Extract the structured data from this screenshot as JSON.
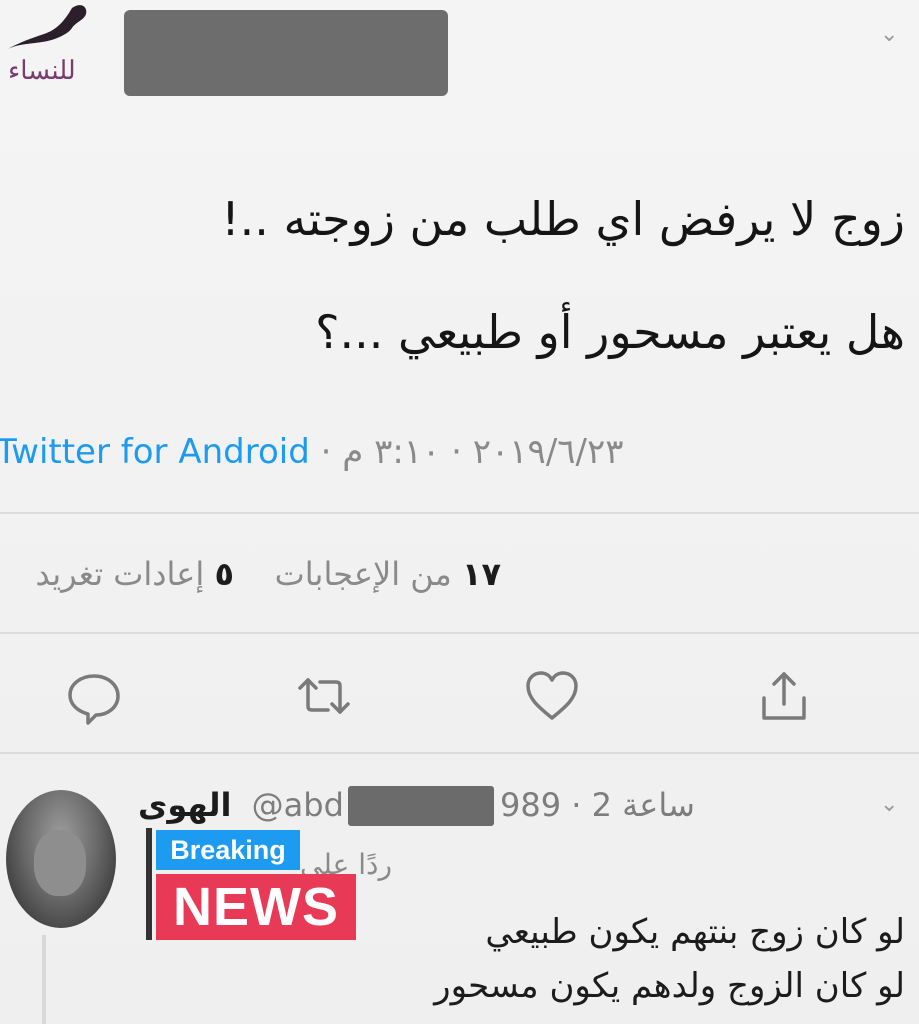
{
  "header": {
    "logo_text": "للنساء"
  },
  "tweet": {
    "line1": "زوج لا يرفض اي طلب من زوجته ..!",
    "line2": "هل يعتبر مسحور أو طبيعي ...؟",
    "time": "٣:١٠ م",
    "date": "٢٠١٩/٦/٢٣",
    "via": "Twitter for Android",
    "likes_count": "١٧",
    "likes_label": "من الإعجابات",
    "retweets_count": "٥",
    "retweets_label": "إعادات تغريد"
  },
  "reply": {
    "name": "الهوى",
    "handle_start": "@abd",
    "handle_end": "989",
    "time": "2 ساعة",
    "reply_to": "ردًا على",
    "line1": "لو كان زوج بنتهم يكون طبيعي",
    "line2": "لو كان الزوج ولدهم يكون مسحور"
  },
  "badge": {
    "top": "Breaking",
    "main": "NEWS"
  },
  "colors": {
    "link": "#1d9bf0",
    "badge_red": "#e83a56",
    "badge_blue": "#1d9bf0"
  }
}
